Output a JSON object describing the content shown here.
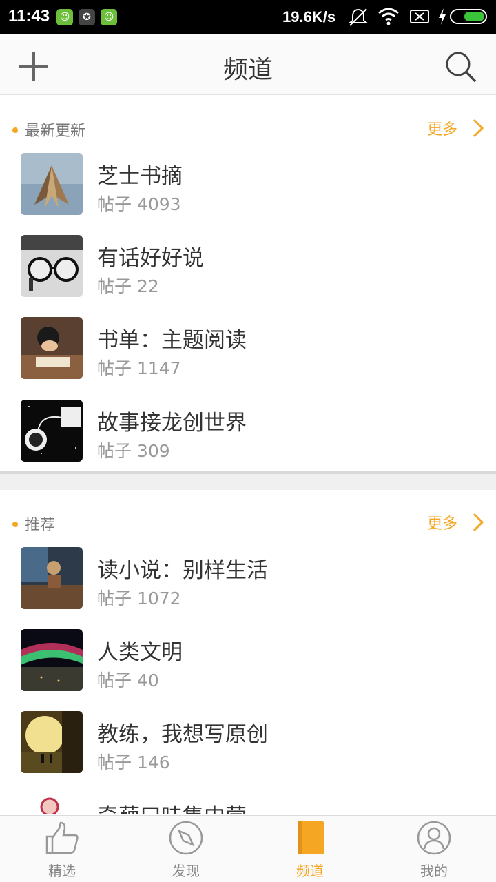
{
  "status_bar": {
    "time": "11:43",
    "speed": "19.6K/s",
    "icons": [
      "android-app-icon",
      "android-app-icon-2",
      "android-app-icon-3",
      "mute-icon",
      "wifi-icon",
      "no-sim-icon",
      "charging-icon",
      "battery-icon"
    ]
  },
  "header": {
    "title": "频道",
    "left_icon": "plus-icon",
    "right_icon": "search-icon"
  },
  "sections": [
    {
      "title": "最新更新",
      "more_label": "更多",
      "items": [
        {
          "title": "芝士书摘",
          "count": "帖子 4093"
        },
        {
          "title": "有话好好说",
          "count": "帖子 22"
        },
        {
          "title": "书单：主题阅读",
          "count": "帖子 1147"
        },
        {
          "title": "故事接龙创世界",
          "count": "帖子 309"
        }
      ]
    },
    {
      "title": "推荐",
      "more_label": "更多",
      "items": [
        {
          "title": "读小说：别样生活",
          "count": "帖子 1072"
        },
        {
          "title": "人类文明",
          "count": "帖子 40"
        },
        {
          "title": "教练，我想写原创",
          "count": "帖子 146"
        },
        {
          "title": "奇葩口味集中营",
          "count": ""
        }
      ]
    }
  ],
  "bottom_nav": {
    "items": [
      {
        "label": "精选",
        "icon": "thumbs-up-icon"
      },
      {
        "label": "发现",
        "icon": "compass-icon"
      },
      {
        "label": "频道",
        "icon": "book-icon"
      },
      {
        "label": "我的",
        "icon": "user-icon"
      }
    ],
    "active": "频道"
  },
  "colors": {
    "accent": "#f5a623",
    "text_primary": "#333333",
    "text_secondary": "#999999"
  }
}
